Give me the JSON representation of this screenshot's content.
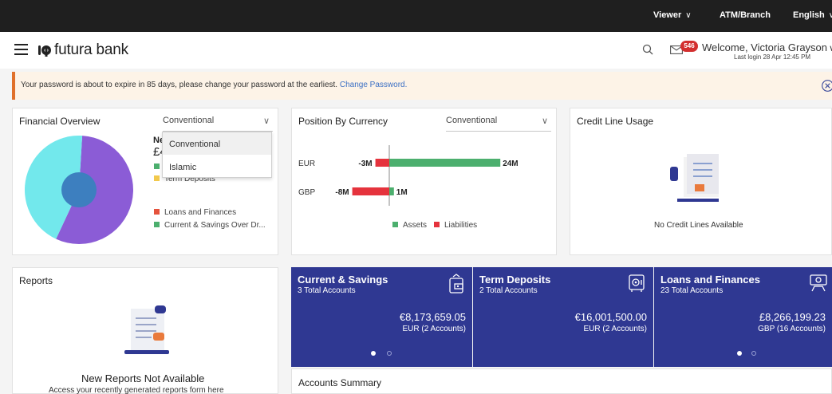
{
  "topbar": {
    "role": "Viewer",
    "branch": "ATM/Branch",
    "language": "English"
  },
  "header": {
    "brand": "futura bank",
    "notification_count": "546",
    "welcome": "Welcome, Victoria Grayson",
    "last_login": "Last login 28 Apr 12:45 PM",
    "icons": [
      "menu-icon",
      "search-icon",
      "mail-icon",
      "chevron-down-icon"
    ]
  },
  "alert": {
    "message": "Your password is about to expire in 85 days, please change your password at the earliest.",
    "link": "Change Password."
  },
  "financial_overview": {
    "title": "Financial Overview",
    "selected": "Conventional",
    "options": [
      "Conventional",
      "Islamic"
    ],
    "net_label": "Ne",
    "net_value": "£4",
    "legend": [
      {
        "label": "Term Deposits",
        "color": "#f2c94c"
      },
      {
        "label": "Loans and Finances",
        "color": "#e5533d"
      },
      {
        "label": "Current & Savings Over Dr...",
        "color": "#4caf6e"
      }
    ],
    "pie": {
      "slices": [
        {
          "value": 56,
          "color": "#8b5cd6"
        },
        {
          "value": 44,
          "color": "#72e8ec"
        }
      ],
      "center_color": "#3d7fbf"
    }
  },
  "position_by_currency": {
    "title": "Position By Currency",
    "selected": "Conventional",
    "legend": [
      {
        "label": "Assets",
        "color": "#4caf6e"
      },
      {
        "label": "Liabilities",
        "color": "#e5333d"
      }
    ]
  },
  "chart_data": {
    "type": "bar",
    "categories": [
      "EUR",
      "GBP"
    ],
    "series": [
      {
        "name": "Assets",
        "values": [
          24,
          1
        ],
        "labels": [
          "24M",
          "1M"
        ]
      },
      {
        "name": "Liabilities",
        "values": [
          -3,
          -8
        ],
        "labels": [
          "-3M",
          "-8M"
        ]
      }
    ]
  },
  "credit_line": {
    "title": "Credit Line Usage",
    "empty": "No Credit Lines Available"
  },
  "reports": {
    "title": "Reports",
    "empty_title": "New Reports Not Available",
    "empty_sub": "Access your recently generated reports form here"
  },
  "accounts": [
    {
      "name": "Current & Savings",
      "count": "3 Total Accounts",
      "amount": "€8,173,659.05",
      "sub": "EUR (2 Accounts)",
      "icon": "wallet-icon"
    },
    {
      "name": "Term Deposits",
      "count": "2 Total Accounts",
      "amount": "€16,001,500.00",
      "sub": "EUR (2 Accounts)",
      "icon": "safe-icon"
    },
    {
      "name": "Loans and Finances",
      "count": "23 Total Accounts",
      "amount": "£8,266,199.23",
      "sub": "GBP (16 Accounts)",
      "icon": "loan-icon"
    }
  ],
  "accounts_summary": {
    "title": "Accounts Summary"
  }
}
